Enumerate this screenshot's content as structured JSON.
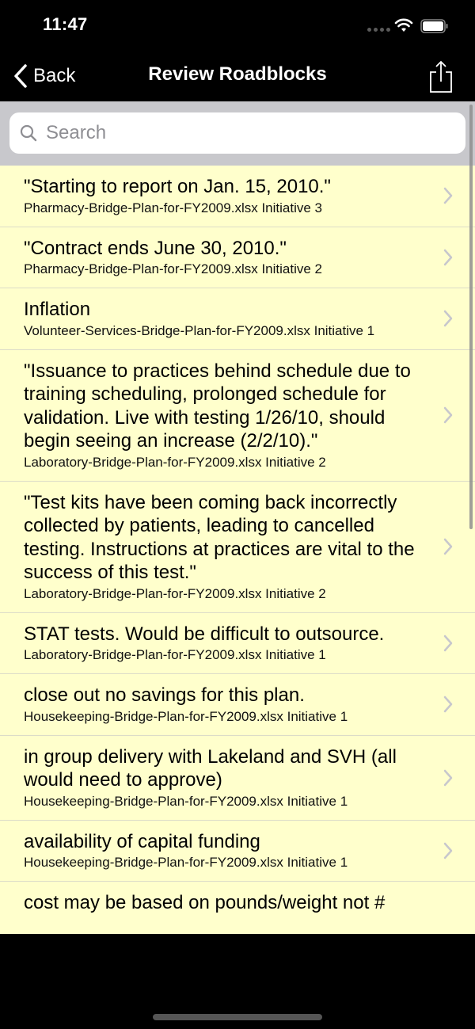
{
  "status_bar": {
    "time": "11:47"
  },
  "nav": {
    "back_label": "Back",
    "title": "Review Roadblocks",
    "share_icon": "share-icon"
  },
  "search": {
    "placeholder": "Search",
    "value": ""
  },
  "colors": {
    "list_background": "#ffffcc",
    "search_area_background": "#c8c8cc",
    "bar_background": "#000000",
    "chevron": "#c7c7cc"
  },
  "roadblocks": [
    {
      "title": "\"Starting to report on Jan. 15, 2010.\"",
      "source": "Pharmacy-Bridge-Plan-for-FY2009.xlsx Initiative 3"
    },
    {
      "title": "\"Contract ends June 30, 2010.\"",
      "source": "Pharmacy-Bridge-Plan-for-FY2009.xlsx Initiative 2"
    },
    {
      "title": "Inflation",
      "source": "Volunteer-Services-Bridge-Plan-for-FY2009.xlsx Initiative 1"
    },
    {
      "title": "\"Issuance to practices behind schedule due to training scheduling, prolonged schedule for validation.  Live with testing 1/26/10, should begin seeing an increase (2/2/10).\"",
      "source": "Laboratory-Bridge-Plan-for-FY2009.xlsx Initiative 2"
    },
    {
      "title": "\"Test kits have been coming back incorrectly collected by patients, leading to cancelled testing.  Instructions at practices are vital to the success of this test.\"",
      "source": "Laboratory-Bridge-Plan-for-FY2009.xlsx Initiative 2"
    },
    {
      "title": "STAT tests. Would be difficult to outsource.",
      "source": "Laboratory-Bridge-Plan-for-FY2009.xlsx Initiative 1"
    },
    {
      "title": "close out no savings for this plan.",
      "source": "Housekeeping-Bridge-Plan-for-FY2009.xlsx Initiative 1"
    },
    {
      "title": "in group delivery with Lakeland and SVH (all would need to approve)",
      "source": "Housekeeping-Bridge-Plan-for-FY2009.xlsx Initiative 1"
    },
    {
      "title": "availability of capital funding",
      "source": "Housekeeping-Bridge-Plan-for-FY2009.xlsx Initiative 1"
    },
    {
      "title": "cost may be based on pounds/weight not #",
      "source": ""
    }
  ]
}
